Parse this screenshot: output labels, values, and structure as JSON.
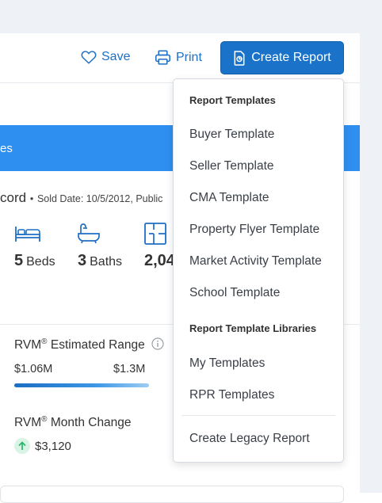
{
  "toolbar": {
    "save_label": "Save",
    "print_label": "Print",
    "create_report_label": "Create Report"
  },
  "banner": {
    "text": "es"
  },
  "record": {
    "title_fragment": "cord",
    "sold_info": "Sold Date: 10/5/2012, Public"
  },
  "stats": {
    "beds_value": "5",
    "beds_label": "Beds",
    "baths_value": "3",
    "baths_label": "Baths",
    "sqft_value": "2,04"
  },
  "rvm": {
    "estimated_range_label": "Estimated Range",
    "prefix": "RVM",
    "reg_mark": "®",
    "low": "$1.06M",
    "high": "$1.3M",
    "month_change_label": "Month Change",
    "month_change_value": "$3,120"
  },
  "dropdown": {
    "section1_header": "Report Templates",
    "templates": [
      "Buyer Template",
      "Seller Template",
      "CMA Template",
      "Property Flyer Template",
      "Market Activity Template",
      "School Template"
    ],
    "section2_header": "Report Template Libraries",
    "libraries": [
      "My Templates",
      "RPR Templates"
    ],
    "legacy_label": "Create Legacy Report"
  },
  "colors": {
    "accent": "#1a73c9",
    "banner": "#2f8ff0",
    "link": "#1f6fc4",
    "positive": "#2bb56b"
  },
  "icons": {
    "save": "heart-icon",
    "print": "printer-icon",
    "create": "report-icon",
    "beds": "bed-icon",
    "baths": "bathtub-icon",
    "sqft": "floorplan-icon",
    "info": "info-icon",
    "change": "arrow-up-icon"
  }
}
